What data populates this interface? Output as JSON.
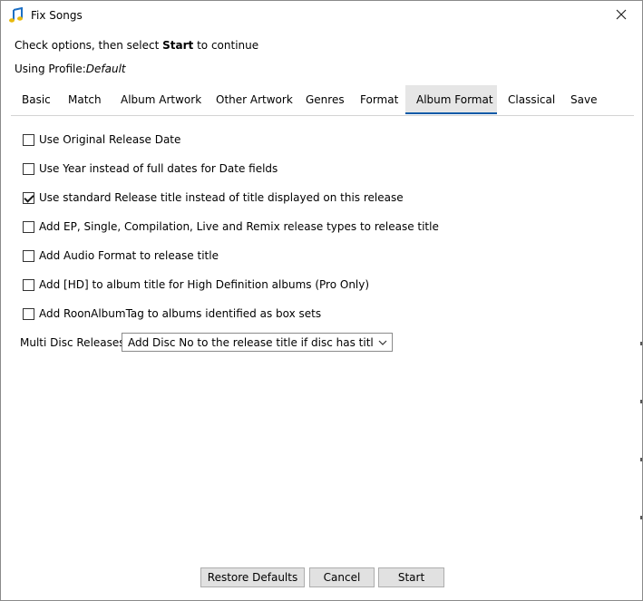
{
  "window": {
    "title": "Fix Songs",
    "close_label": "✕"
  },
  "instructions": {
    "prefix": "Check options, then select ",
    "bold": "Start",
    "suffix": " to continue"
  },
  "profile": {
    "label": "Using Profile:",
    "value": "Default"
  },
  "tabs": [
    {
      "label": "Basic",
      "active": false
    },
    {
      "label": "Match",
      "active": false
    },
    {
      "label": "Album Artwork",
      "active": false
    },
    {
      "label": "Other Artwork",
      "active": false
    },
    {
      "label": "Genres",
      "active": false
    },
    {
      "label": "Format",
      "active": false
    },
    {
      "label": "Album Format",
      "active": true
    },
    {
      "label": "Classical",
      "active": false
    },
    {
      "label": "Save",
      "active": false
    }
  ],
  "options": [
    {
      "label": "Use Original Release Date",
      "checked": false
    },
    {
      "label": "Use Year instead of full dates for Date fields",
      "checked": false
    },
    {
      "label": "Use standard Release title instead of title displayed on this release",
      "checked": true
    },
    {
      "label": "Add EP, Single, Compilation, Live and Remix release types to release title",
      "checked": false
    },
    {
      "label": "Add Audio Format to release title",
      "checked": false
    },
    {
      "label": "Add [HD] to album title for High Definition albums (Pro Only)",
      "checked": false
    },
    {
      "label": "Add RoonAlbumTag to albums identified as box sets",
      "checked": false
    }
  ],
  "multi_disc": {
    "label": "Multi Disc Releases :",
    "value": "Add Disc No to the release title if disc has title"
  },
  "buttons": {
    "restore": "Restore Defaults",
    "cancel": "Cancel",
    "start": "Start"
  },
  "colors": {
    "accent": "#0a5ba8",
    "active_tab_bg": "#e6e6e6",
    "button_bg": "#e1e1e1"
  },
  "icons": {
    "app": "music-note-icon",
    "close": "close-icon",
    "dropdown": "chevron-down-icon",
    "check": "checkmark-icon"
  }
}
